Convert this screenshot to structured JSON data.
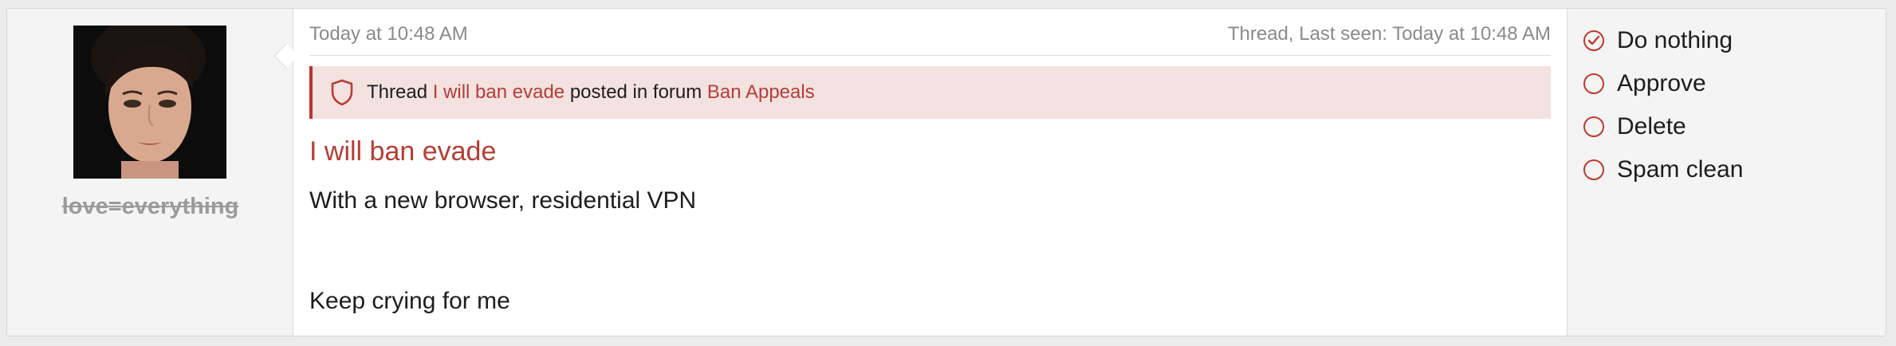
{
  "user": {
    "username": "love=everything"
  },
  "post": {
    "timestamp": "Today at 10:48 AM",
    "last_seen": "Thread, Last seen: Today at 10:48 AM",
    "notice": {
      "prefix": "Thread",
      "thread_link": "I will ban evade",
      "middle": "posted in forum",
      "forum_link": "Ban Appeals"
    },
    "title": "I will ban evade",
    "body_line_1": "With a new browser, residential VPN",
    "body_line_2": "Keep crying for me"
  },
  "actions": [
    {
      "label": "Do nothing",
      "selected": true
    },
    {
      "label": "Approve",
      "selected": false
    },
    {
      "label": "Delete",
      "selected": false
    },
    {
      "label": "Spam clean",
      "selected": false
    }
  ],
  "colors": {
    "accent": "#b53d34",
    "notice_bg": "#f4e2e1"
  },
  "icons": {
    "notice": "shield-icon",
    "selected_action": "check-circle-icon",
    "unselected_action": "radio-empty-icon"
  }
}
